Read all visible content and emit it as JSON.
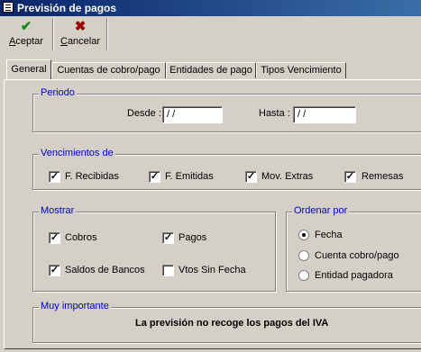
{
  "window": {
    "title": "Previsión de pagos"
  },
  "toolbar": {
    "aceptar": {
      "label": "Aceptar",
      "mnemonic": "A",
      "rest": "ceptar",
      "icon": "check-icon",
      "color": "#1a8a1a"
    },
    "cancelar": {
      "label": "Cancelar",
      "mnemonic": "C",
      "rest": "ancelar",
      "icon": "cross-icon",
      "color": "#a00000"
    }
  },
  "tabs": [
    {
      "label": "General",
      "active": true
    },
    {
      "label": "Cuentas de cobro/pago",
      "active": false
    },
    {
      "label": "Entidades de pago",
      "active": false
    },
    {
      "label": "Tipos Vencimiento",
      "active": false
    }
  ],
  "periodo": {
    "legend": "Periodo",
    "desde_label": "Desde :",
    "desde_value": " / /",
    "hasta_label": "Hasta :",
    "hasta_value": " / /"
  },
  "vencimientos": {
    "legend": "Vencimientos de",
    "items": [
      {
        "label": "F. Recibidas",
        "checked": true
      },
      {
        "label": "F. Emitidas",
        "checked": true
      },
      {
        "label": "Mov. Extras",
        "checked": true
      },
      {
        "label": "Remesas",
        "checked": true
      }
    ]
  },
  "mostrar": {
    "legend": "Mostrar",
    "items": [
      {
        "label": "Cobros",
        "checked": true
      },
      {
        "label": "Pagos",
        "checked": true
      },
      {
        "label": "Saldos de Bancos",
        "checked": true
      },
      {
        "label": "Vtos Sin Fecha",
        "checked": false
      }
    ]
  },
  "ordenar": {
    "legend": "Ordenar por",
    "options": [
      {
        "label": "Fecha",
        "selected": true
      },
      {
        "label": "Cuenta cobro/pago",
        "selected": false
      },
      {
        "label": "Entidad pagadora",
        "selected": false
      }
    ]
  },
  "importante": {
    "legend": "Muy importante",
    "message": "La previsión no recoge los pagos del IVA"
  },
  "colors": {
    "titlebar": "#0a246a",
    "legend": "#0000c8",
    "face": "#d4d0c8"
  }
}
